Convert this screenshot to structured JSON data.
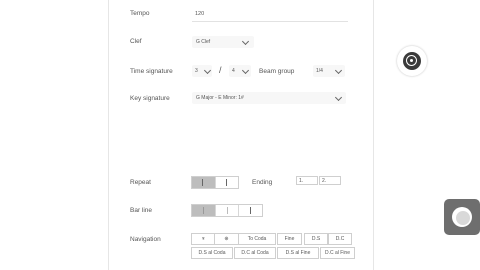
{
  "form": {
    "tempo": {
      "label": "Tempo",
      "value": "120"
    },
    "clef": {
      "label": "Clef",
      "value": "G Clef"
    },
    "time_signature": {
      "label": "Time signature",
      "numerator": "3",
      "separator": "/",
      "denominator": "4"
    },
    "beam_group": {
      "label": "Beam group",
      "value": "1/4"
    },
    "key_signature": {
      "label": "Key signature",
      "value": "G Major - E Minor: 1#"
    },
    "repeat": {
      "label": "Repeat"
    },
    "ending": {
      "label": "Ending",
      "field1": "1.",
      "field2": "2."
    },
    "bar_line": {
      "label": "Bar line"
    },
    "navigation": {
      "label": "Navigation",
      "row1": [
        "𝄋",
        "⊕",
        "To Coda",
        "Fine",
        "D.S",
        "D.C"
      ],
      "row2": [
        "D.S al Coda",
        "D.C al Coda",
        "D.S al Fine",
        "D.C al Fine"
      ]
    }
  },
  "icons": {
    "floating_button": "record-target-icon",
    "record_button": "record-circle-icon"
  }
}
